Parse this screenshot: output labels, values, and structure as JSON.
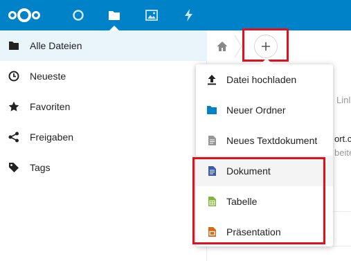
{
  "header": {
    "logo": "nextcloud-logo",
    "apps": [
      {
        "name": "dashboard",
        "icon": "circle-icon"
      },
      {
        "name": "files",
        "icon": "folder-icon",
        "active": true
      },
      {
        "name": "photos",
        "icon": "image-icon"
      },
      {
        "name": "activity",
        "icon": "lightning-icon"
      }
    ],
    "accent": "#0082c9"
  },
  "sidebar": {
    "items": [
      {
        "label": "Alle Dateien",
        "icon": "folder-icon",
        "active": true
      },
      {
        "label": "Neueste",
        "icon": "clock-icon"
      },
      {
        "label": "Favoriten",
        "icon": "star-icon"
      },
      {
        "label": "Freigaben",
        "icon": "share-icon"
      },
      {
        "label": "Tags",
        "icon": "tag-icon"
      }
    ]
  },
  "breadcrumb": {
    "home_icon": "home-icon",
    "add_icon": "plus-icon"
  },
  "background_text": {
    "peek1": "Linl",
    "peek2": "ort.c",
    "peek3": "beite"
  },
  "new_menu": {
    "items": [
      {
        "label": "Datei hochladen",
        "icon": "upload-icon"
      },
      {
        "label": "Neuer Ordner",
        "icon": "folder-icon"
      },
      {
        "label": "Neues Textdokument",
        "icon": "text-file-icon"
      },
      {
        "label": "Dokument",
        "icon": "document-icon"
      },
      {
        "label": "Tabelle",
        "icon": "spreadsheet-icon"
      },
      {
        "label": "Präsentation",
        "icon": "presentation-icon"
      }
    ]
  },
  "colors": {
    "highlight": "#e2101c",
    "document": "#3e5ba9",
    "spreadsheet": "#85b43a",
    "presentation": "#d36a1c"
  }
}
